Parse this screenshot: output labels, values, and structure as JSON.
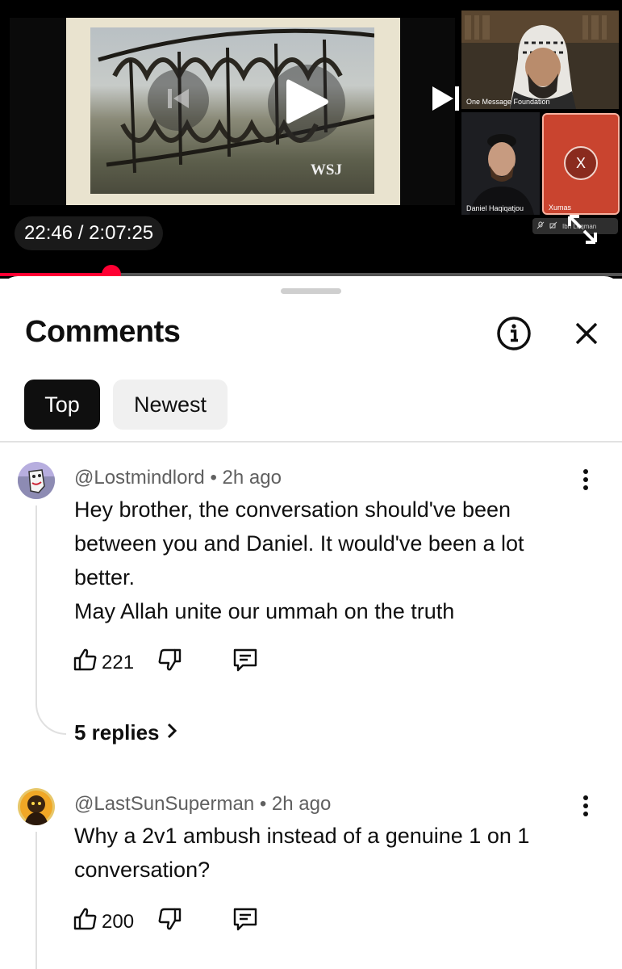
{
  "player": {
    "time_display": "22:46 / 2:07:25",
    "progress_fraction": 0.1791,
    "watermark": "WSJ",
    "participants": [
      {
        "name": "One Message Foundation"
      },
      {
        "name": "Daniel Haqiqatjou"
      },
      {
        "name": "Xumas",
        "avatar_letter": "X"
      }
    ],
    "mini_label": "Ibn Luqman",
    "colors": {
      "progress": "#ff0033",
      "speaker_tile": "#c9442f"
    }
  },
  "comments_panel": {
    "title": "Comments",
    "info_icon": "info-icon",
    "close_icon": "close-icon",
    "filters": [
      {
        "label": "Top",
        "selected": true
      },
      {
        "label": "Newest",
        "selected": false
      }
    ],
    "comments": [
      {
        "author": "@Lostmindlord",
        "time": "2h ago",
        "lines": [
          "Hey brother, the conversation should've been",
          "between you and Daniel. It would've been a lot",
          "better.",
          "May Allah unite our ummah on the truth"
        ],
        "likes": "221",
        "replies_label": "5 replies"
      },
      {
        "author": "@LastSunSuperman",
        "time": "2h ago",
        "lines": [
          "Why a 2v1 ambush instead of a genuine 1 on 1",
          "conversation?"
        ],
        "likes": "200"
      }
    ]
  }
}
